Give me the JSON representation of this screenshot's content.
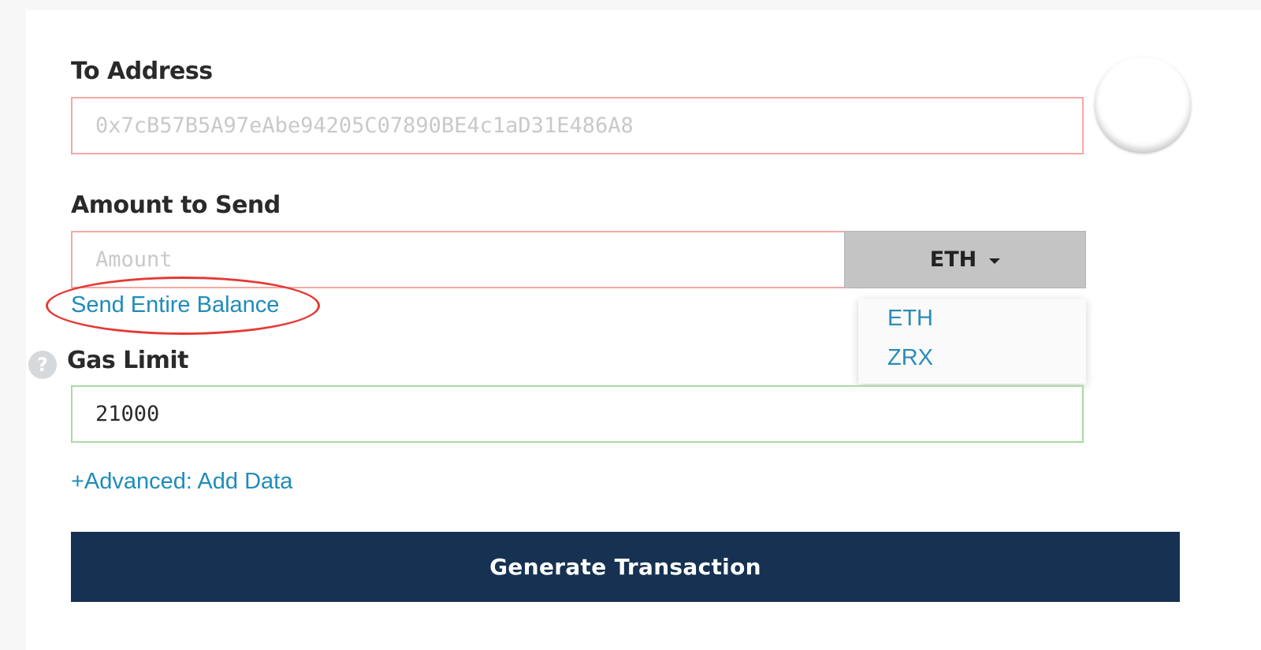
{
  "to_address": {
    "label": "To Address",
    "placeholder": "0x7cB57B5A97eAbe94205C07890BE4c1aD31E486A8",
    "value": ""
  },
  "amount": {
    "label": "Amount to Send",
    "placeholder": "Amount",
    "value": "",
    "currency_selected": "ETH",
    "currency_options": [
      "ETH",
      "ZRX"
    ],
    "send_entire_balance": "Send Entire Balance"
  },
  "gas_limit": {
    "label": "Gas Limit",
    "value": "21000",
    "help_symbol": "?"
  },
  "advanced_link": "+Advanced: Add Data",
  "generate_button": "Generate Transaction",
  "colors": {
    "link": "#1f8cb8",
    "invalid_border": "#f3a9a4",
    "valid_border": "#a8dba3",
    "button_bg": "#163151",
    "annotation": "#e53935"
  },
  "icons": {
    "identicon": "blank-identicon",
    "help": "question-circle-icon",
    "caret": "caret-down-icon"
  }
}
